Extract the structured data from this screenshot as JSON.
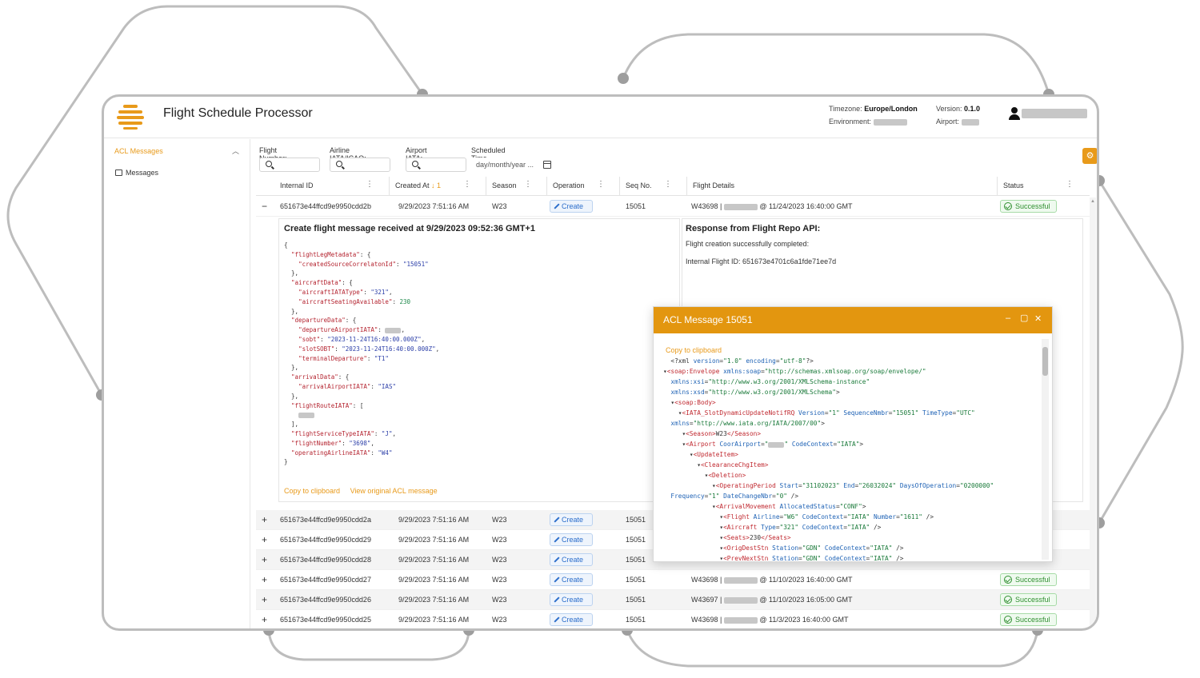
{
  "header": {
    "app_title": "Flight Schedule Processor",
    "timezone_label": "Timezone:",
    "timezone_value": "Europe/London",
    "environment_label": "Environment:",
    "version_label": "Version:",
    "version_value": "0.1.0",
    "airport_label": "Airport:"
  },
  "sidebar": {
    "section_label": "ACL Messages",
    "item_label": "Messages"
  },
  "filters": {
    "flight_number_label": "Flight Number:",
    "airline_label": "Airline IATA/ICAO:",
    "airport_label": "Airport IATA:",
    "scheduled_time_label": "Scheduled Time (Local):",
    "scheduled_time_placeholder": "day/month/year ..."
  },
  "grid": {
    "columns": [
      "Internal ID",
      "Created At",
      "Season",
      "Operation",
      "Seq No.",
      "Flight Details",
      "Status"
    ],
    "sort_indicator": "↓ 1",
    "create_label": "Create",
    "successful_label": "Successful",
    "rows": [
      {
        "expander": "−",
        "id": "651673e44ffcd9e9950cdd2b",
        "created": "9/29/2023 7:51:16 AM",
        "season": "W23",
        "seq": "15051",
        "flight": "W43698 |",
        "sched": "@ 11/24/2023 16:40:00 GMT",
        "status": "Successful"
      },
      {
        "expander": "+",
        "id": "651673e44ffcd9e9950cdd2a",
        "created": "9/29/2023 7:51:16 AM",
        "season": "W23",
        "seq": "15051"
      },
      {
        "expander": "+",
        "id": "651673e44ffcd9e9950cdd29",
        "created": "9/29/2023 7:51:16 AM",
        "season": "W23",
        "seq": "15051"
      },
      {
        "expander": "+",
        "id": "651673e44ffcd9e9950cdd28",
        "created": "9/29/2023 7:51:16 AM",
        "season": "W23",
        "seq": "15051"
      },
      {
        "expander": "+",
        "id": "651673e44ffcd9e9950cdd27",
        "created": "9/29/2023 7:51:16 AM",
        "season": "W23",
        "seq": "15051",
        "flight": "W43698 |",
        "sched": "@ 11/10/2023 16:40:00 GMT",
        "status": "Successful"
      },
      {
        "expander": "+",
        "id": "651673e44ffcd9e9950cdd26",
        "created": "9/29/2023 7:51:16 AM",
        "season": "W23",
        "seq": "15051",
        "flight": "W43697 |",
        "sched": "@ 11/10/2023 16:05:00 GMT",
        "status": "Successful"
      },
      {
        "expander": "+",
        "id": "651673e44ffcd9e9950cdd25",
        "created": "9/29/2023 7:51:16 AM",
        "season": "W23",
        "seq": "15051",
        "flight": "W43698 |",
        "sched": "@ 11/3/2023 16:40:00 GMT",
        "status": "Successful"
      }
    ]
  },
  "detail": {
    "json_title": "Create flight message received at 9/29/2023 09:52:36 GMT+1",
    "copy_label": "Copy to clipboard",
    "view_original_label": "View original ACL message",
    "response_title": "Response from Flight Repo API:",
    "response_line1": "Flight creation successfully completed:",
    "response_line2": "Internal Flight ID: 651673e4701c6a1fde71ee7d"
  },
  "modal": {
    "title": "ACL Message 15051",
    "copy_label": "Copy to clipboard"
  },
  "colors": {
    "accent": "#e89a1a",
    "modal_bar": "#e3960f",
    "success": "#2f8f2f",
    "link_blue": "#2c6ecb"
  },
  "icons": [
    "logo-icon",
    "user-icon",
    "chevron-up-icon",
    "inbox-icon",
    "search-icon",
    "calendar-icon",
    "settings-icon",
    "kebab-icon",
    "pencil-icon",
    "check-circle-icon",
    "minimize-icon",
    "maximize-icon",
    "close-icon"
  ]
}
